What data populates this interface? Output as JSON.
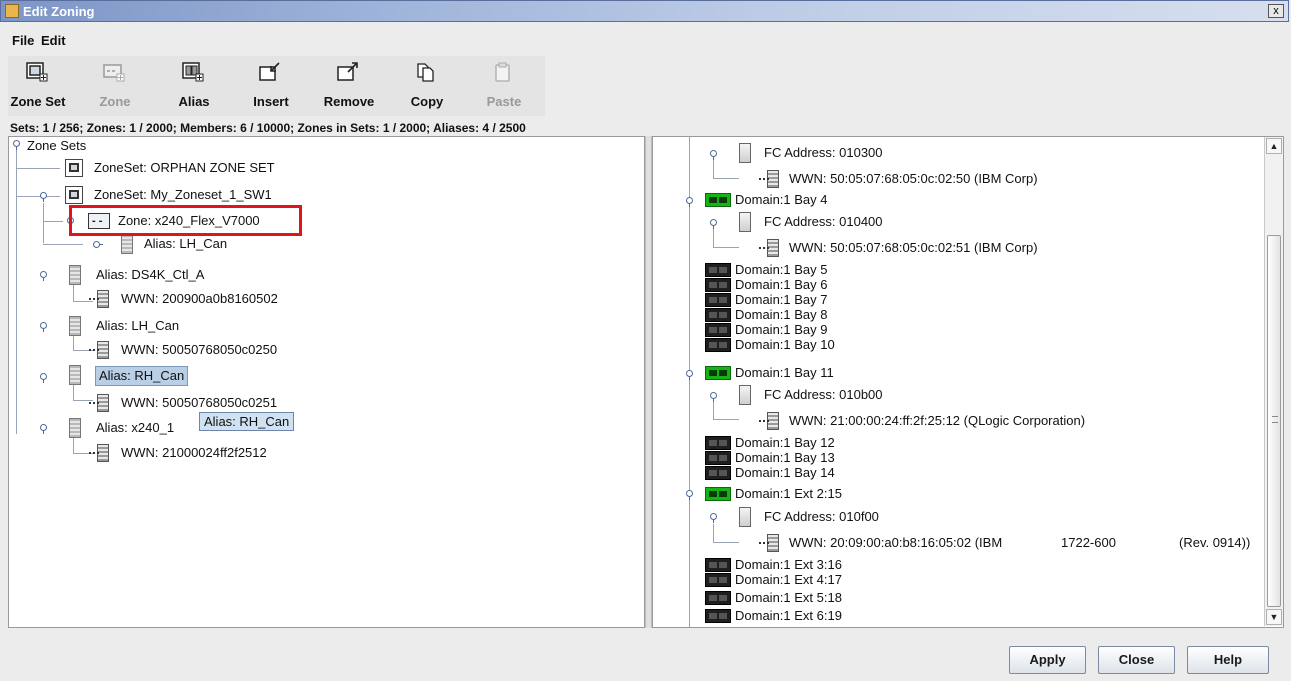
{
  "window": {
    "title": "Edit Zoning",
    "close_label": "x"
  },
  "menu": {
    "file": "File",
    "edit": "Edit"
  },
  "toolbar": [
    {
      "label": "Zone Set",
      "enabled": true,
      "icon": "zone-set-icon"
    },
    {
      "label": "Zone",
      "enabled": false,
      "icon": "zone-icon"
    },
    {
      "label": "Alias",
      "enabled": true,
      "icon": "alias-icon"
    },
    {
      "label": "Insert",
      "enabled": true,
      "icon": "insert-icon"
    },
    {
      "label": "Remove",
      "enabled": true,
      "icon": "remove-icon"
    },
    {
      "label": "Copy",
      "enabled": true,
      "icon": "copy-icon"
    },
    {
      "label": "Paste",
      "enabled": false,
      "icon": "paste-icon"
    }
  ],
  "status": "Sets: 1 / 256; Zones: 1 / 2000; Members: 6 / 10000; Zones in Sets: 1 / 2000; Aliases: 4 / 2500",
  "left_tree": {
    "root": "Zone Sets",
    "orphan_set": "ZoneSet: ORPHAN ZONE SET",
    "zoneset": "ZoneSet: My_Zoneset_1_SW1",
    "zone": "Zone: x240_Flex_V7000",
    "zone_alias": "Alias: LH_Can",
    "alias1": "Alias: DS4K_Ctl_A",
    "alias1_wwn": "WWN: 200900a0b8160502",
    "alias2": "Alias: LH_Can",
    "alias2_wwn": "WWN: 50050768050c0250",
    "alias3": "Alias: RH_Can",
    "alias3_wwn": "WWN: 50050768050c0251",
    "alias4": "Alias: x240_1",
    "alias4_wwn": "WWN: 21000024ff2f2512",
    "tooltip": "Alias: RH_Can"
  },
  "right_tree": {
    "fc1": "FC Address: 010300",
    "wwn1": "WWN: 50:05:07:68:05:0c:02:50 (IBM Corp)",
    "bay4": "Domain:1 Bay 4",
    "fc2": "FC Address: 010400",
    "wwn2": "WWN: 50:05:07:68:05:0c:02:51 (IBM Corp)",
    "bays_a": [
      "Domain:1 Bay 5",
      "Domain:1 Bay 6",
      "Domain:1 Bay 7",
      "Domain:1 Bay 8",
      "Domain:1 Bay 9",
      "Domain:1 Bay 10"
    ],
    "bay11": "Domain:1 Bay 11",
    "fc3": "FC Address: 010b00",
    "wwn3": "WWN: 21:00:00:24:ff:2f:25:12 (QLogic Corporation)",
    "bays_b": [
      "Domain:1 Bay 12",
      "Domain:1 Bay 13",
      "Domain:1 Bay 14"
    ],
    "ext215": "Domain:1 Ext 2:15",
    "fc4": "FC Address: 010f00",
    "wwn4_a": "WWN: 20:09:00:a0:b8:16:05:02 (IBM",
    "wwn4_b": "1722-600",
    "wwn4_c": "(Rev. 0914))",
    "exts": [
      "Domain:1 Ext 3:16",
      "Domain:1 Ext 4:17",
      "Domain:1 Ext 5:18",
      "Domain:1 Ext 6:19"
    ]
  },
  "buttons": {
    "apply": "Apply",
    "close": "Close",
    "help": "Help"
  },
  "colors": {
    "highlight": "#e0141a",
    "selection": "#b8cfe5",
    "active_port": "#13b413"
  }
}
